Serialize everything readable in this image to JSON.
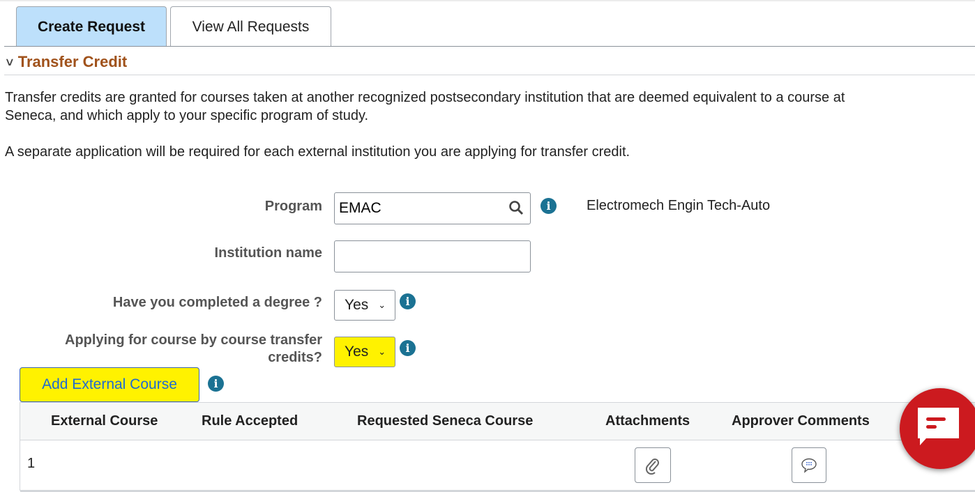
{
  "tabs": [
    {
      "label": "Create Request",
      "active": true
    },
    {
      "label": "View All Requests",
      "active": false
    }
  ],
  "section": {
    "title": "Transfer Credit"
  },
  "intro": {
    "paragraph1_line1": "Transfer credits are granted for courses taken at another recognized postsecondary institution that are deemed equivalent to a course at",
    "paragraph1_line2": "Seneca, and which apply to your specific program of study.",
    "paragraph2": "A separate application will be required for each external institution you are applying for transfer credit."
  },
  "form": {
    "program": {
      "label": "Program",
      "value": "EMAC",
      "description": "Electromech Engin Tech-Auto"
    },
    "institution": {
      "label": "Institution name",
      "value": ""
    },
    "degree": {
      "label": "Have you completed a degree ?",
      "value": "Yes"
    },
    "course_by_course": {
      "label_line1": "Applying for course by course transfer",
      "label_line2": "credits?",
      "value": "Yes"
    },
    "add_button": "Add External Course"
  },
  "grid": {
    "columns": [
      "External Course",
      "Rule Accepted",
      "Requested Seneca Course",
      "Attachments",
      "Approver Comments"
    ],
    "rows": [
      {
        "num": "1"
      }
    ]
  },
  "colors": {
    "active_tab": "#bde0fb",
    "section_title": "#a0521b",
    "highlight": "#fff200",
    "info": "#1b7293",
    "chat": "#cc1a1f"
  }
}
